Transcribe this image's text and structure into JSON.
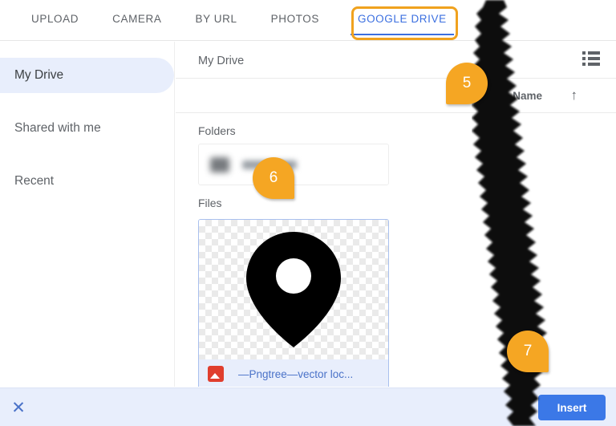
{
  "tabs": [
    {
      "label": "UPLOAD",
      "active": false
    },
    {
      "label": "CAMERA",
      "active": false
    },
    {
      "label": "BY URL",
      "active": false
    },
    {
      "label": "PHOTOS",
      "active": false
    },
    {
      "label": "GOOGLE DRIVE",
      "active": true
    }
  ],
  "sidebar": {
    "items": [
      {
        "label": "My Drive",
        "selected": true
      },
      {
        "label": "Shared with me",
        "selected": false
      },
      {
        "label": "Recent",
        "selected": false
      }
    ]
  },
  "main": {
    "breadcrumb": "My Drive",
    "list_view_icon": "list-view-icon",
    "column_header": {
      "name_label": "Name",
      "sort_arrow": "↑"
    },
    "folders_label": "Folders",
    "folders": [
      {
        "name": "",
        "redacted": true
      }
    ],
    "files_label": "Files",
    "files": [
      {
        "name": "—Pngtree—vector loc...",
        "type_icon": "image-file-icon",
        "thumbnail": "location-pin-graphic",
        "selected": true
      }
    ]
  },
  "bottom_bar": {
    "close_icon": "✕",
    "insert_label": "Insert"
  },
  "callouts": [
    {
      "number": "5",
      "direction": "down-left"
    },
    {
      "number": "6",
      "direction": "down-right"
    },
    {
      "number": "7",
      "direction": "down-right"
    }
  ],
  "colors": {
    "accent_blue": "#3b78e7",
    "tab_active_blue": "#3b6fe0",
    "callout_orange": "#f5a623",
    "highlight_orange": "#f0a21e",
    "selection_bg": "#e8eefc",
    "text_gray": "#5f6368"
  }
}
